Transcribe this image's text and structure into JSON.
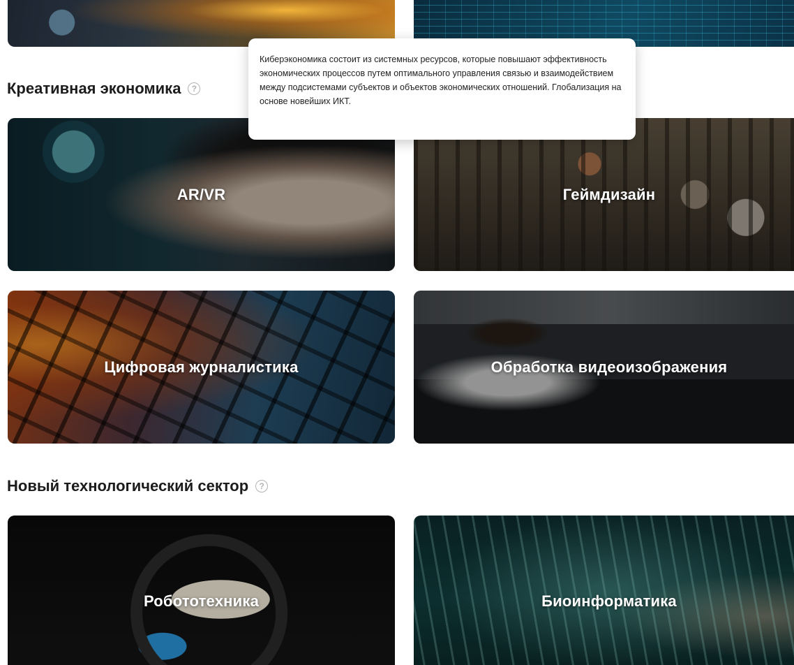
{
  "tooltip": {
    "text": "Киберэкономика состоит из системных ресурсов, которые повышают эффективность экономических процессов путем оптимального управления связью и взаимодействием между подсистемами субъектов и объектов экономических отношений. Глобализация на основе новейших ИКТ."
  },
  "sections": [
    {
      "title": "Креативная экономика",
      "help_icon": "question-circle-icon",
      "cards": [
        {
          "label": "AR/VR"
        },
        {
          "label": "Геймдизайн"
        },
        {
          "label": "Цифровая журналистика"
        },
        {
          "label": "Обработка видеоизображения"
        }
      ]
    },
    {
      "title": "Новый технологический сектор",
      "help_icon": "question-circle-icon",
      "cards": [
        {
          "label": "Робототехника"
        },
        {
          "label": "Биоинформатика"
        }
      ]
    }
  ],
  "help_glyph": "?",
  "colors": {
    "text": "#1c1c1c",
    "help_icon": "#b3b3b3",
    "card_label": "#ffffff"
  }
}
